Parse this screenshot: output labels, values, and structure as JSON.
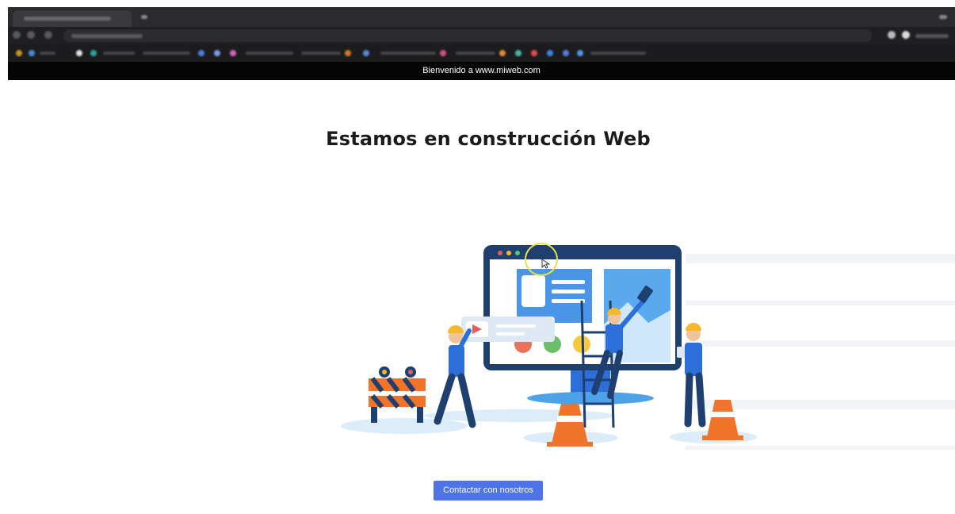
{
  "welcome_bar": {
    "text": "Bienvenido a www.miweb.com"
  },
  "main": {
    "heading": "Estamos en construcción Web",
    "contact_button_label": "Contactar con nosotros"
  },
  "illustration": {
    "name": "under-construction-illustration",
    "icons": [
      "monitor-icon",
      "worker-icon",
      "traffic-cone-icon",
      "barrier-icon",
      "ladder-icon",
      "paint-roller-icon",
      "play-icon",
      "cursor-icon"
    ]
  },
  "colors": {
    "welcome_bar_bg": "#050505",
    "button_bg": "#4f73e8",
    "monitor_blue": "#2d6fd8",
    "cone_orange": "#f0742a",
    "helmet_yellow": "#f5b82e",
    "cursor_ring": "#e5e046"
  }
}
